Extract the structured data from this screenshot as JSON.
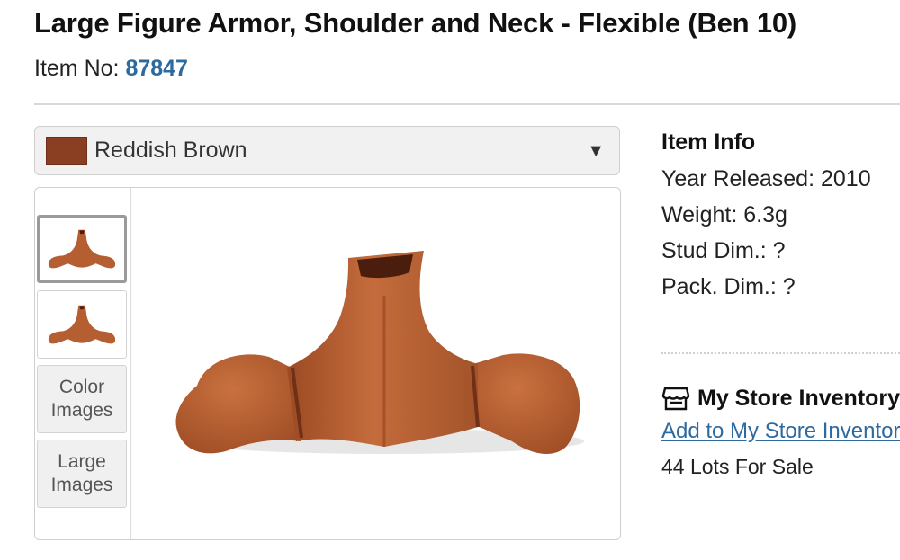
{
  "header": {
    "title": "Large Figure Armor, Shoulder and Neck - Flexible (Ben 10)",
    "item_no_label": "Item No:",
    "item_no": "87847"
  },
  "color_select": {
    "selected": "Reddish Brown",
    "swatch_color": "#8b3f22"
  },
  "gallery": {
    "buttons": [
      "Color Images",
      "Large Images"
    ]
  },
  "item_info": {
    "title": "Item Info",
    "year_released": "Year Released: 2010",
    "weight": "Weight: 6.3g",
    "stud_dim": "Stud Dim.: ?",
    "pack_dim": "Pack. Dim.: ?"
  },
  "store": {
    "title": "My Store Inventory",
    "link": "Add to My Store Inventor",
    "lots": "44 Lots For Sale"
  },
  "colors": {
    "link": "#2d6aa0",
    "part": "#b55e32"
  }
}
